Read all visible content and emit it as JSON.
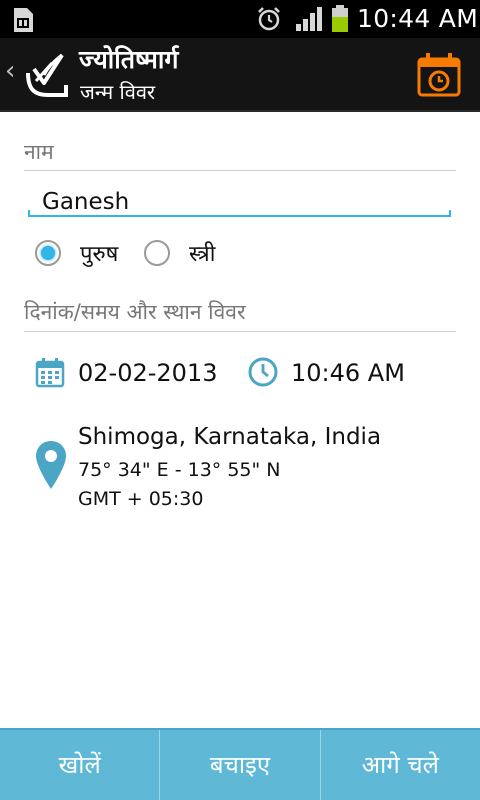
{
  "status": {
    "time": "10:44 AM"
  },
  "header": {
    "title": "ज्योतिष्मार्ग",
    "subtitle": "जन्म विवर"
  },
  "form": {
    "name_label": "नाम",
    "name_value": "Ganesh",
    "gender_options": [
      {
        "label": "पुरुष",
        "selected": true
      },
      {
        "label": "स्त्री",
        "selected": false
      }
    ],
    "datetime_section_label": "दिनांक/समय और स्थान विवर",
    "date": "02-02-2013",
    "time": "10:46 AM",
    "place": "Shimoga, Karnataka, India",
    "coordinates": "75° 34\"  E - 13° 55\"  N",
    "timezone": "GMT + 05:30"
  },
  "footer": {
    "buttons": [
      "खोलें",
      "बचाइए",
      "आगे चले"
    ]
  },
  "colors": {
    "accent": "#33b5e5",
    "orange": "#f57c00",
    "footer_bg": "#5fb8d6",
    "icon_blue": "#4aa6c4"
  }
}
